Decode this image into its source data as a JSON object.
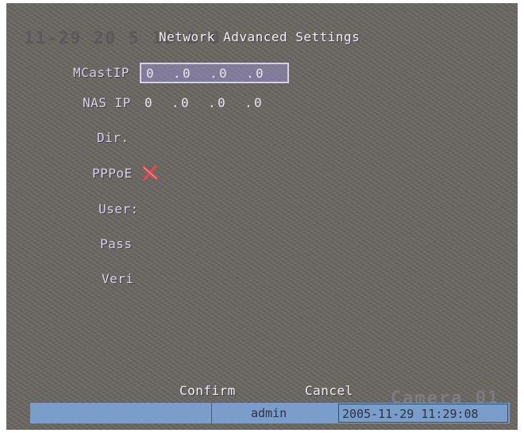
{
  "overlay": {
    "ghost_datetime": "11-29 20 5 10 1 0",
    "ghost_camera": "Camera 01"
  },
  "dialog": {
    "title": "Network Advanced Settings",
    "fields": {
      "mcast_ip": {
        "label": "MCastIP",
        "octets": [
          "0",
          "0",
          "0",
          "0"
        ]
      },
      "nas_ip": {
        "label": "NAS IP",
        "octets": [
          "0",
          "0",
          "0",
          "0"
        ]
      },
      "dir": {
        "label": "Dir."
      },
      "pppoe": {
        "label": "PPPoE",
        "icon": "cross-icon",
        "enabled": false
      },
      "user": {
        "label": "User:"
      },
      "pass": {
        "label": "Pass"
      },
      "veri": {
        "label": "Veri"
      }
    },
    "buttons": {
      "confirm": "Confirm",
      "cancel": "Cancel"
    }
  },
  "status_bar": {
    "user": "admin",
    "datetime": "2005-11-29 11:29:08"
  },
  "colors": {
    "background": "#6b6762",
    "text": "#f2eef6",
    "highlight": "#9c8ccf",
    "cross": "#e0484a",
    "status_bar": "#7a9ec9"
  }
}
